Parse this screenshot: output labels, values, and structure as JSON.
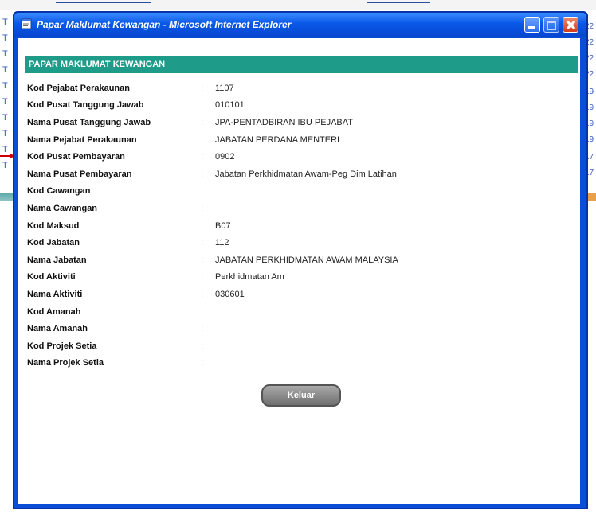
{
  "window": {
    "title": "Papar Maklumat Kewangan - Microsoft Internet Explorer"
  },
  "section": {
    "heading": "PAPAR MAKLUMAT KEWANGAN"
  },
  "fields": [
    {
      "label": "Kod Pejabat Perakaunan",
      "colon": ":",
      "value": "1107"
    },
    {
      "label": "Kod Pusat Tanggung Jawab",
      "colon": ":",
      "value": "010101"
    },
    {
      "label": "Nama Pusat Tanggung Jawab",
      "colon": ":",
      "value": "JPA-PENTADBIRAN IBU PEJABAT"
    },
    {
      "label": "Nama Pejabat Perakaunan",
      "colon": ":",
      "value": "JABATAN PERDANA MENTERI"
    },
    {
      "label": "Kod Pusat Pembayaran",
      "colon": ":",
      "value": "0902"
    },
    {
      "label": "Nama Pusat Pembayaran",
      "colon": ":",
      "value": "Jabatan Perkhidmatan Awam-Peg Dim Latihan"
    },
    {
      "label": "Kod Cawangan",
      "colon": ":",
      "value": ""
    },
    {
      "label": "Nama Cawangan",
      "colon": ":",
      "value": ""
    },
    {
      "label": "Kod Maksud",
      "colon": ":",
      "value": "B07"
    },
    {
      "label": "Kod Jabatan",
      "colon": ":",
      "value": "112"
    },
    {
      "label": "Nama Jabatan",
      "colon": ":",
      "value": "JABATAN PERKHIDMATAN AWAM MALAYSIA"
    },
    {
      "label": "Kod Aktiviti",
      "colon": ":",
      "value": "Perkhidmatan Am"
    },
    {
      "label": "Nama Aktiviti",
      "colon": ":",
      "value": "030601"
    },
    {
      "label": "Kod Amanah",
      "colon": ":",
      "value": ""
    },
    {
      "label": "Nama Amanah",
      "colon": ":",
      "value": ""
    },
    {
      "label": "Kod Projek Setia",
      "colon": ":",
      "value": ""
    },
    {
      "label": "Nama Projek Setia",
      "colon": ":",
      "value": ""
    }
  ],
  "buttons": {
    "keluar": "Keluar"
  },
  "background": {
    "left_letters": [
      "T",
      "T",
      "T",
      "T",
      "T",
      "T",
      "T",
      "T",
      "T",
      "T"
    ],
    "right_numbers": [
      "22",
      "22",
      "22",
      "22",
      "19",
      "19",
      "19",
      "19",
      "17",
      "17"
    ]
  },
  "colors": {
    "titlebar": "#0a58e8",
    "section_bar": "#1f9b8a",
    "button": "#8a8a8a"
  }
}
